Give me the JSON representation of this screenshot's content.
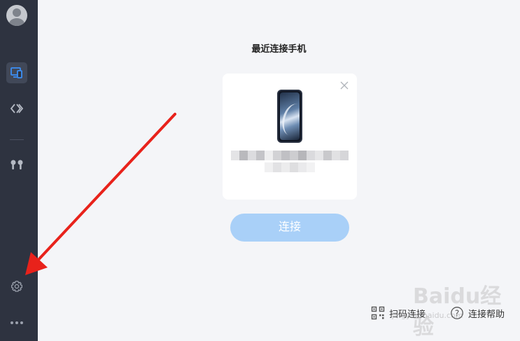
{
  "sidebar": {
    "items": [
      {
        "name": "devices",
        "icon": "phone-monitor-icon",
        "active": true
      },
      {
        "name": "connect",
        "icon": "diamond-code-icon",
        "active": false
      },
      {
        "name": "earbuds",
        "icon": "earbuds-icon",
        "active": false
      },
      {
        "name": "settings",
        "icon": "gear-icon",
        "active": false
      },
      {
        "name": "more",
        "icon": "more-dots-icon",
        "active": false
      }
    ]
  },
  "main": {
    "title": "最近连接手机",
    "card": {
      "close_icon": "close-icon"
    },
    "connect_label": "连接",
    "footer": {
      "scan_label": "扫码连接",
      "help_label": "连接帮助"
    }
  },
  "watermark": {
    "text": "Baidu经验",
    "sub": "jingyan.baidu.com"
  },
  "colors": {
    "sidebar_bg": "#2e3340",
    "accent": "#3b8ff5",
    "button_disabled": "#a9d0f8",
    "arrow": "#e8221b"
  }
}
